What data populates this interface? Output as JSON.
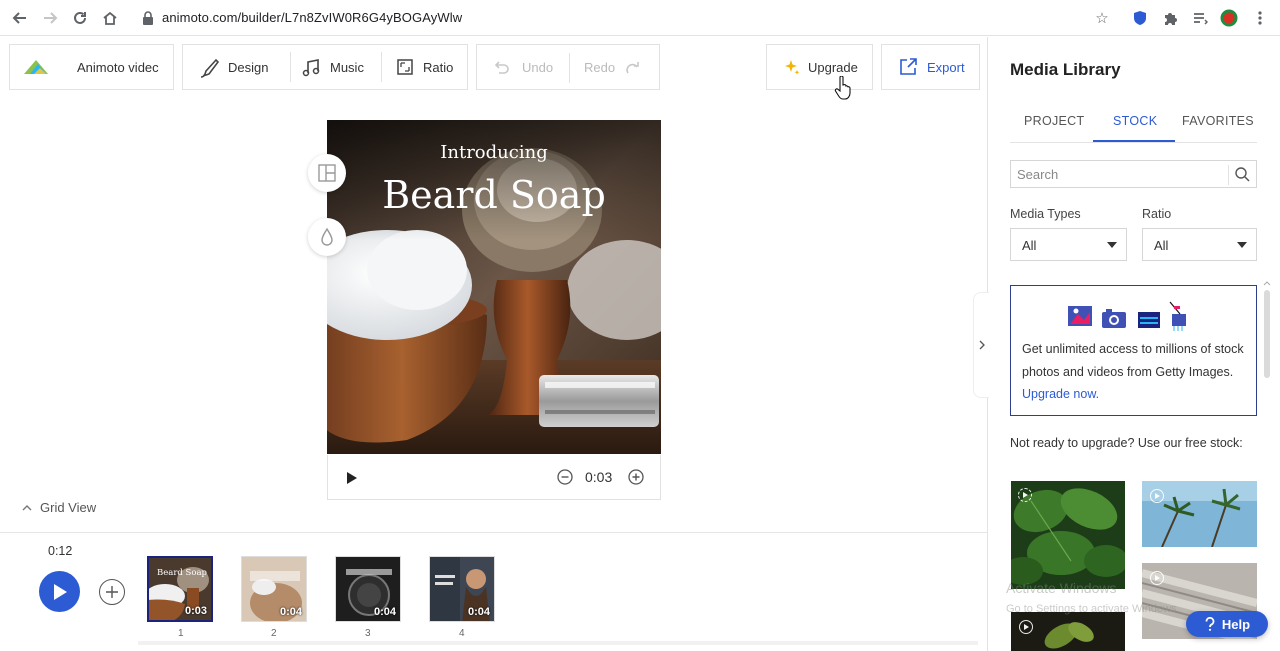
{
  "browser": {
    "url": "animoto.com/builder/L7n8ZvIW0R6G4yBOGAyWlw"
  },
  "toolbar": {
    "project_name": "Animoto videc",
    "design_label": "Design",
    "music_label": "Music",
    "ratio_label": "Ratio",
    "undo_label": "Undo",
    "redo_label": "Redo",
    "upgrade_label": "Upgrade",
    "export_label": "Export"
  },
  "preview": {
    "title_line1": "Introducing",
    "title_line2": "Beard Soap",
    "duration": "0:03"
  },
  "timeline": {
    "grid_view_label": "Grid View",
    "total_time": "0:12",
    "scenes": [
      {
        "number": "1",
        "duration": "0:03",
        "caption": "Beard Soap"
      },
      {
        "number": "2",
        "duration": "0:04"
      },
      {
        "number": "3",
        "duration": "0:04"
      },
      {
        "number": "4",
        "duration": "0:04"
      }
    ]
  },
  "media_library": {
    "title": "Media Library",
    "tabs": [
      "PROJECT",
      "STOCK",
      "FAVORITES"
    ],
    "active_tab": "STOCK",
    "search_placeholder": "Search",
    "filters": {
      "media_types_label": "Media Types",
      "media_types_value": "All",
      "ratio_label": "Ratio",
      "ratio_value": "All"
    },
    "promo": {
      "text": "Get unlimited access to millions of stock photos and videos from Getty Images.",
      "link": "Upgrade now."
    },
    "free_stock_text": "Not ready to upgrade? Use our free stock:",
    "help_label": "Help",
    "watermark_line1": "Activate Windows",
    "watermark_line2": "Go to Settings to activate Windows."
  },
  "colors": {
    "accent": "#2c5bd3",
    "play_button": "#2c5bd3",
    "promo_border": "#2c3e8c"
  }
}
